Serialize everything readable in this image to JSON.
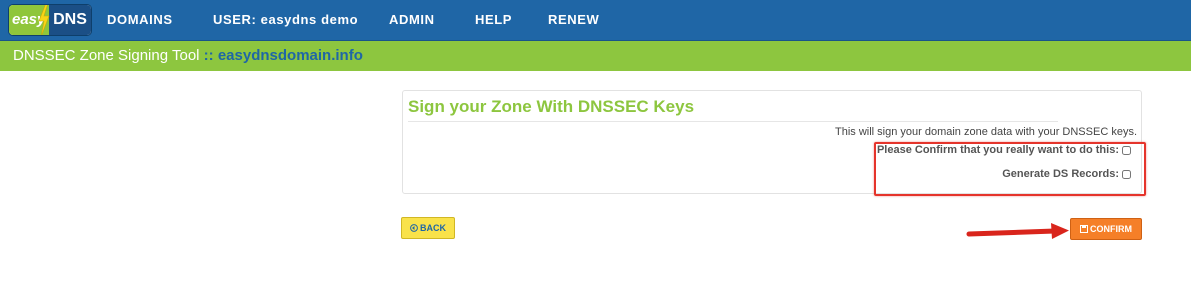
{
  "brand": {
    "logo_left": "easy",
    "logo_right": "DNS"
  },
  "nav": {
    "items": [
      "DOMAINS",
      "USER: easydns demo",
      "ADMIN",
      "HELP",
      "RENEW"
    ]
  },
  "subbar": {
    "tool": "DNSSEC Zone Signing Tool",
    "separator": " :: ",
    "domain": "easydnsdomain.info"
  },
  "panel": {
    "title": "Sign your Zone With DNSSEC Keys",
    "description": "This will sign your domain zone data with your DNSSEC keys.",
    "confirm_label": "Please Confirm that you really want to do this:",
    "confirm_checked": false,
    "ds_label": "Generate DS Records:",
    "ds_checked": false
  },
  "buttons": {
    "back": "BACK",
    "confirm": "CONFIRM"
  },
  "colors": {
    "nav": "#1f66a6",
    "subbar": "#8dc63f",
    "title": "#8dc63f",
    "highlight": "#e5342b",
    "back": "#f9e24a",
    "confirm": "#f57f28"
  }
}
